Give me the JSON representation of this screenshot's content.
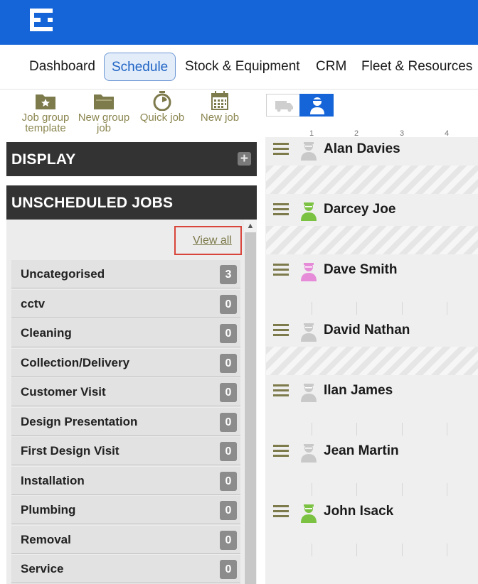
{
  "nav": {
    "items": [
      "Dashboard",
      "Schedule",
      "Stock & Equipment",
      "CRM",
      "Fleet & Resources"
    ],
    "active": "Schedule"
  },
  "toolbar": {
    "job_group_template": {
      "line1": "Job group",
      "line2": "template",
      "icon": "folder-star-icon"
    },
    "new_group_job": {
      "line1": "New group",
      "line2": "job",
      "icon": "folder-icon"
    },
    "quick_job": {
      "line1": "Quick job",
      "icon": "stopwatch-icon"
    },
    "new_job": {
      "line1": "New job",
      "icon": "calendar-icon"
    }
  },
  "view_toggles": [
    {
      "icon": "van-icon",
      "active": false
    },
    {
      "icon": "person-icon",
      "active": true
    }
  ],
  "display_panel": {
    "title": "DISPLAY"
  },
  "unscheduled_panel": {
    "title": "UNSCHEDULED JOBS",
    "view_all": "View all",
    "categories": [
      {
        "label": "Uncategorised",
        "count": "3"
      },
      {
        "label": "cctv",
        "count": "0"
      },
      {
        "label": "Cleaning",
        "count": "0"
      },
      {
        "label": "Collection/Delivery",
        "count": "0"
      },
      {
        "label": "Customer Visit",
        "count": "0"
      },
      {
        "label": "Design Presentation",
        "count": "0"
      },
      {
        "label": "First Design Visit",
        "count": "0"
      },
      {
        "label": "Installation",
        "count": "0"
      },
      {
        "label": "Plumbing",
        "count": "0"
      },
      {
        "label": "Removal",
        "count": "0"
      },
      {
        "label": "Service",
        "count": "0"
      }
    ]
  },
  "schedule": {
    "hours": [
      "1",
      "2",
      "3",
      "4"
    ],
    "resources": [
      {
        "name": "Alan Davies",
        "avatar_color": "#c9c9c9",
        "hatched": true
      },
      {
        "name": "Darcey Joe",
        "avatar_color": "#7cc242",
        "hatched": true
      },
      {
        "name": "Dave Smith",
        "avatar_color": "#e58bd8",
        "hatched": false
      },
      {
        "name": "David Nathan",
        "avatar_color": "#c9c9c9",
        "hatched": true
      },
      {
        "name": "Ilan James",
        "avatar_color": "#c9c9c9",
        "hatched": false
      },
      {
        "name": "Jean Martin",
        "avatar_color": "#c9c9c9",
        "hatched": false
      },
      {
        "name": "John Isack",
        "avatar_color": "#7cc242",
        "hatched": false
      }
    ]
  }
}
